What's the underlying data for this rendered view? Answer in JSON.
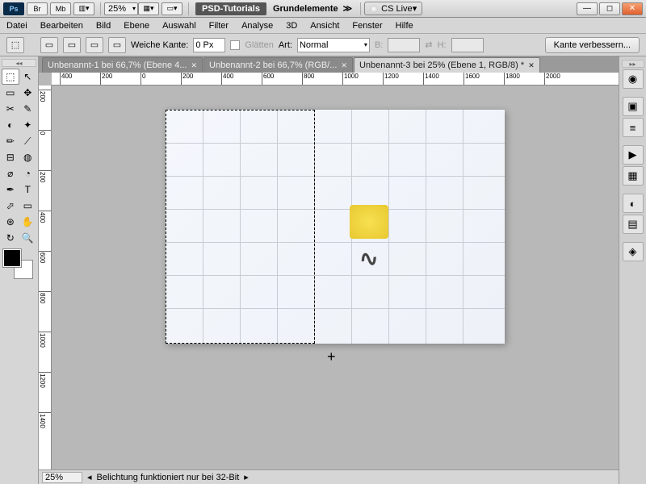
{
  "titlebar": {
    "br": "Br",
    "mb": "Mb",
    "zoom": "25%",
    "title": "PSD-Tutorials",
    "subtitle": "Grundelemente",
    "cslive": "CS Live"
  },
  "menu": [
    "Datei",
    "Bearbeiten",
    "Bild",
    "Ebene",
    "Auswahl",
    "Filter",
    "Analyse",
    "3D",
    "Ansicht",
    "Fenster",
    "Hilfe"
  ],
  "options": {
    "weiche_kante_label": "Weiche Kante:",
    "weiche_kante_value": "0 Px",
    "glatten": "Glätten",
    "art_label": "Art:",
    "art_value": "Normal",
    "b_label": "B:",
    "h_label": "H:",
    "refine": "Kante verbessern..."
  },
  "tabs": [
    {
      "label": "Unbenannt-1 bei 66,7% (Ebene 4...",
      "active": false
    },
    {
      "label": "Unbenannt-2 bei 66,7% (RGB/...",
      "active": false
    },
    {
      "label": "Unbenannt-3 bei 25% (Ebene 1, RGB/8) *",
      "active": true
    }
  ],
  "ruler_h": [
    "400",
    "200",
    "0",
    "200",
    "400",
    "600",
    "800",
    "1000",
    "1200",
    "1400",
    "1600",
    "1800",
    "2000"
  ],
  "ruler_v": [
    "200",
    "0",
    "200",
    "400",
    "600",
    "800",
    "1000",
    "1200",
    "1400"
  ],
  "status": {
    "zoom": "25%",
    "msg": "Belichtung funktioniert nur bei 32-Bit"
  },
  "tools": [
    [
      "⬚",
      "↖"
    ],
    [
      "▭",
      "✥"
    ],
    [
      "✂",
      "✎"
    ],
    [
      "◐",
      "✦"
    ],
    [
      "✏",
      "⟋"
    ],
    [
      "⊟",
      "◍"
    ],
    [
      "⌀",
      "◔"
    ],
    [
      "✒",
      "T"
    ],
    [
      "⬀",
      "▭"
    ],
    [
      "⊛",
      "✋"
    ],
    [
      "↻",
      "🔍"
    ]
  ],
  "panels_right": [
    "◉",
    "▣",
    "≡",
    "▶",
    "▦",
    "◐",
    "▤",
    "◈"
  ]
}
